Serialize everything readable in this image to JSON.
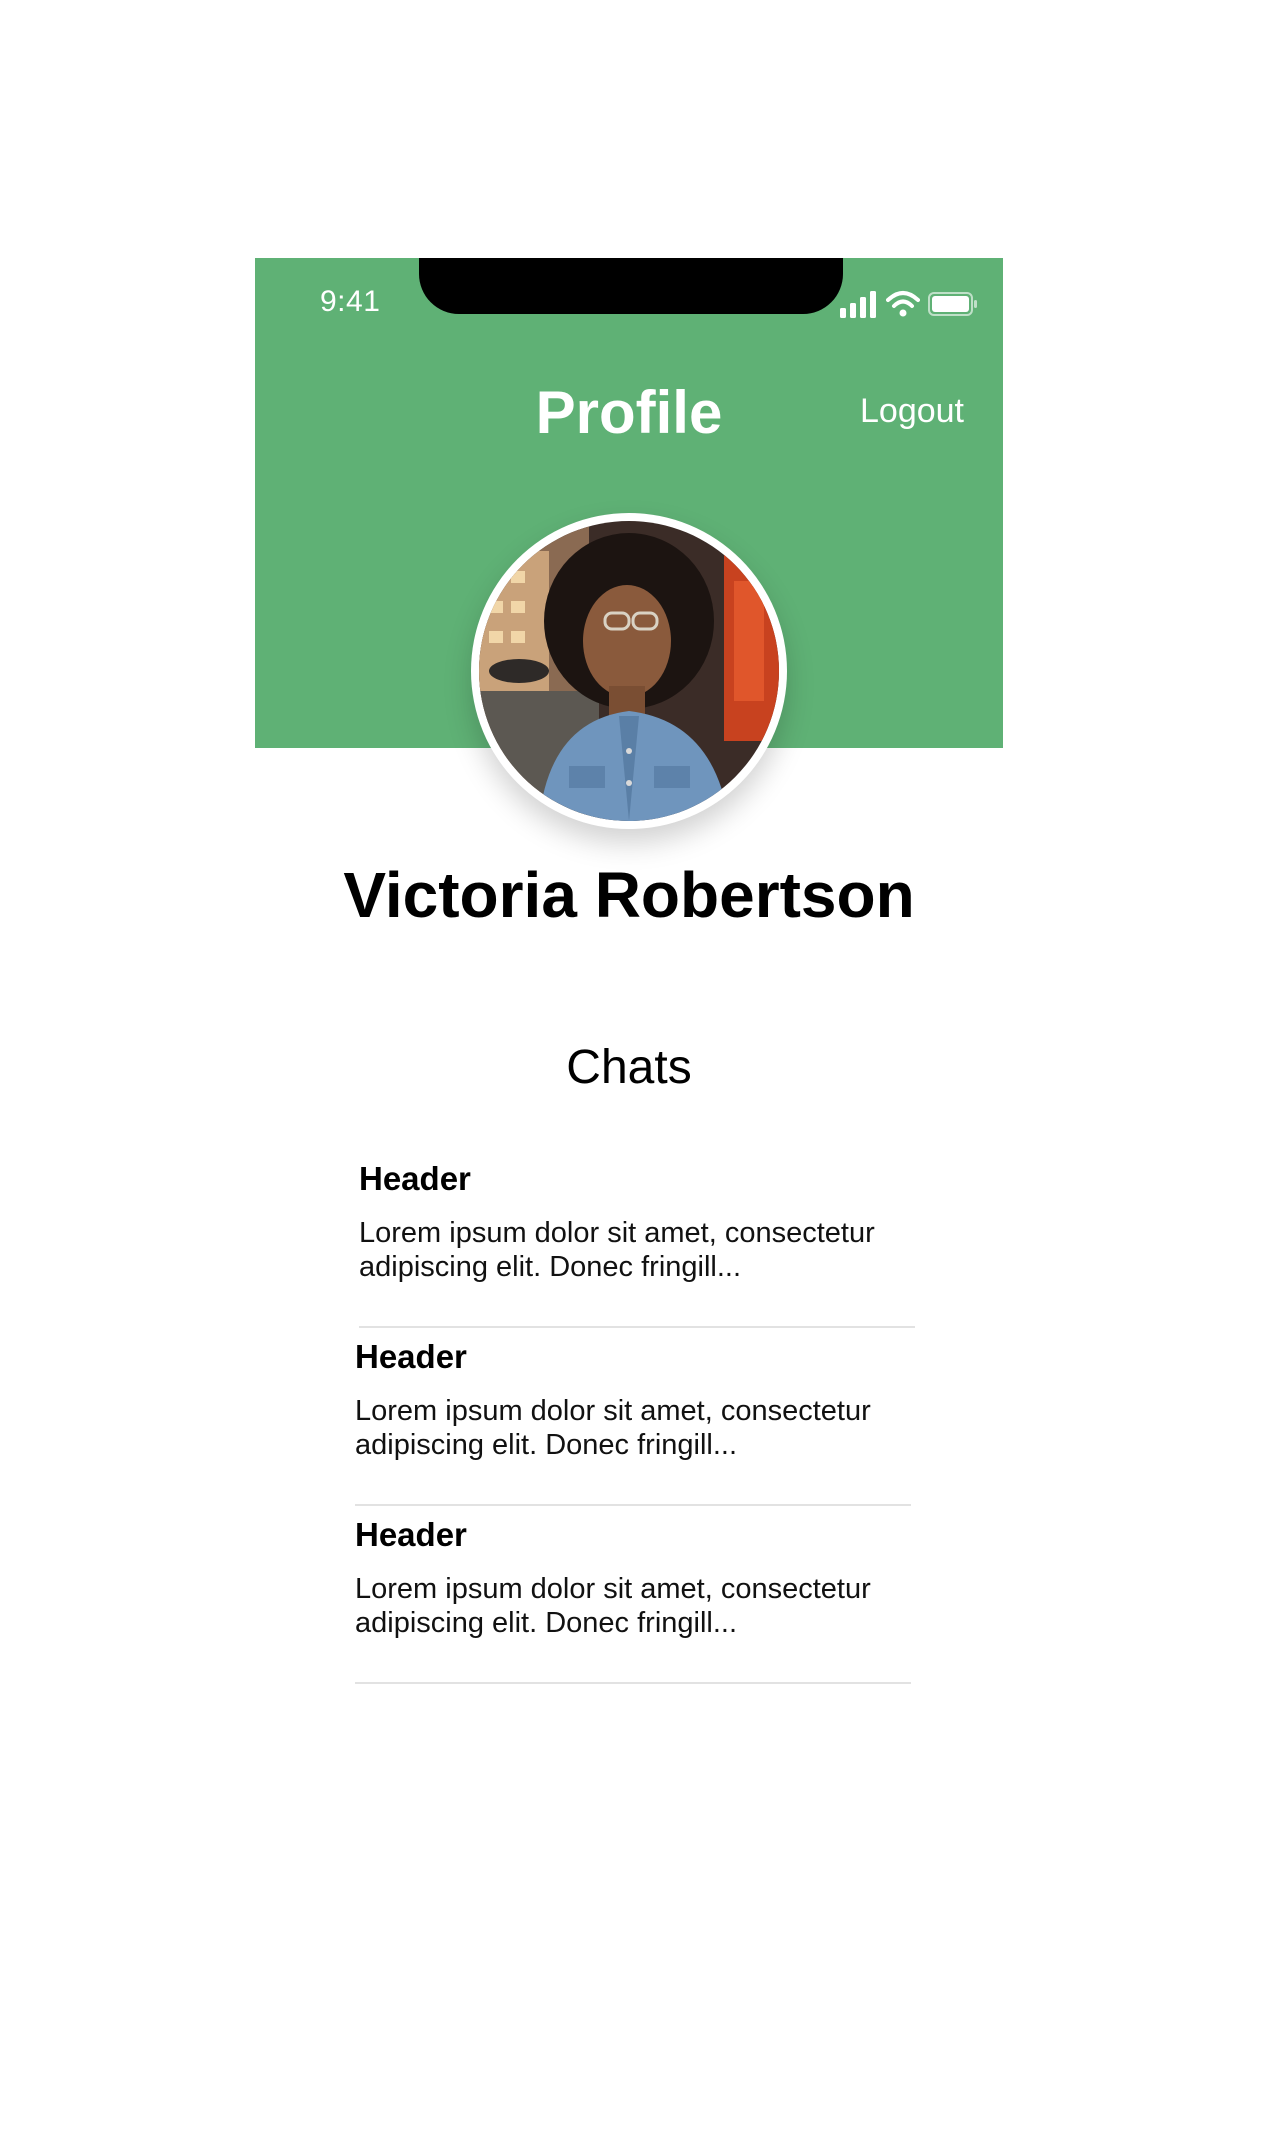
{
  "status_bar": {
    "time": "9:41",
    "icons": [
      "signal-icon",
      "wifi-icon",
      "battery-icon"
    ]
  },
  "header": {
    "title": "Profile",
    "logout_label": "Logout",
    "background_color": "#5fb175"
  },
  "profile": {
    "name": "Victoria Robertson",
    "avatar_icon": "profile-photo"
  },
  "chats": {
    "title": "Chats",
    "items": [
      {
        "header": "Header",
        "body": "Lorem ipsum dolor sit amet, consectetur adipiscing elit. Donec fringill..."
      },
      {
        "header": "Header",
        "body": "Lorem ipsum dolor sit amet, consectetur adipiscing elit. Donec fringill..."
      },
      {
        "header": "Header",
        "body": "Lorem ipsum dolor sit amet, consectetur adipiscing elit. Donec fringill..."
      }
    ]
  }
}
